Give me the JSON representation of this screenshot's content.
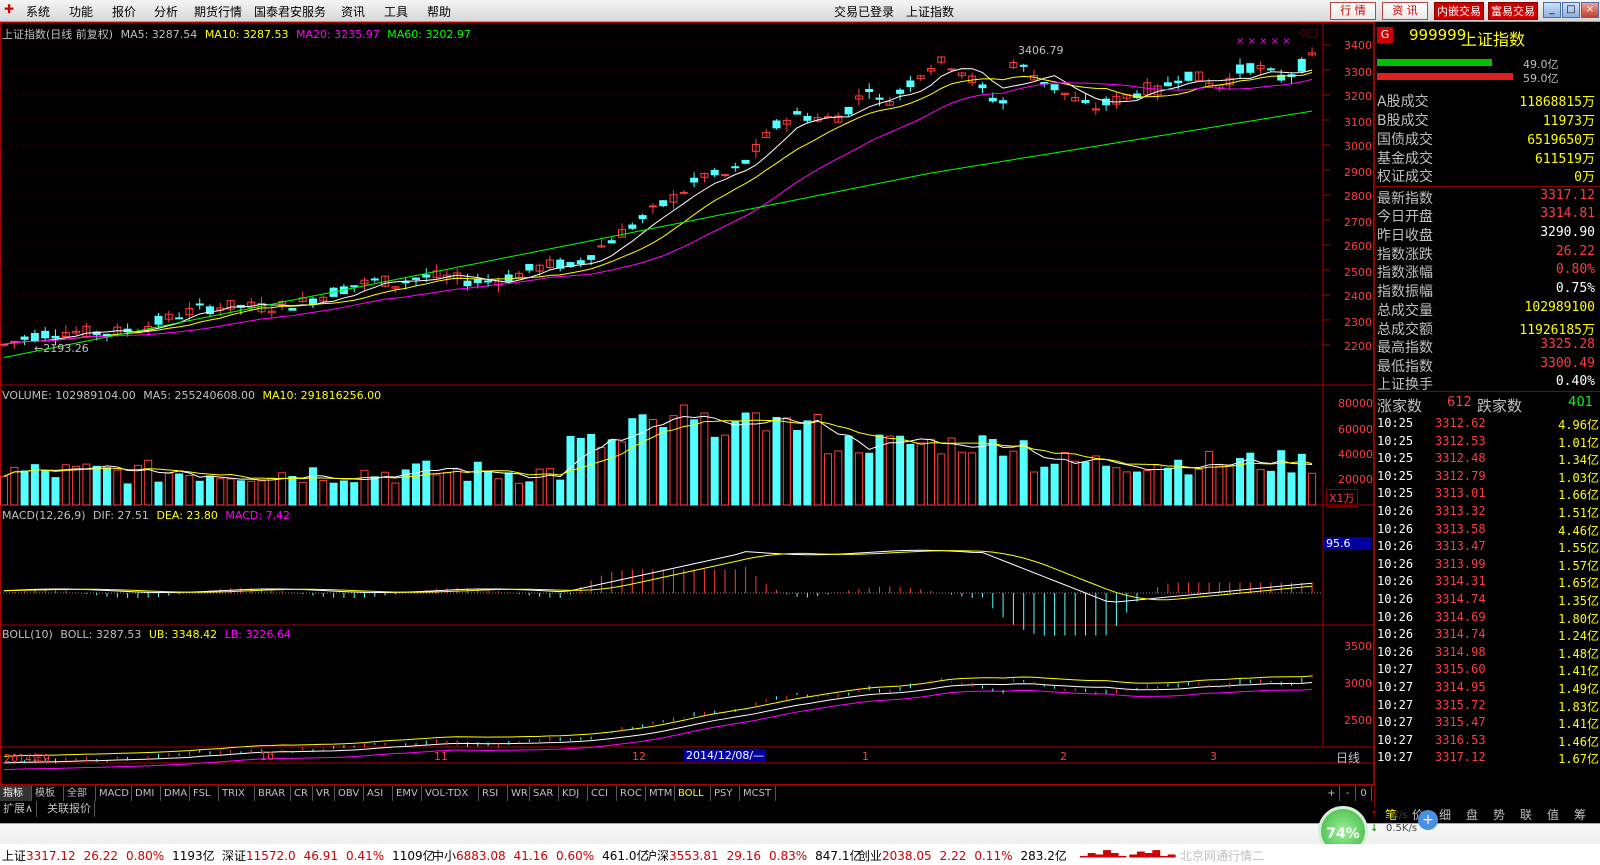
{
  "menu": {
    "items": [
      "系统",
      "功能",
      "报价",
      "分析",
      "期货行情",
      "国泰君安服务",
      "资讯",
      "工具",
      "帮助"
    ],
    "status_text": "交易已登录",
    "index_name": "上证指数",
    "buttons": [
      "行 情",
      "资 讯"
    ],
    "red_buttons": [
      "内嵌交易",
      "富易交易"
    ]
  },
  "main_panel": {
    "title": "上证指数(日线 前复权)",
    "ma5": "MA5: 3287.54",
    "ma10": "MA10: 3287.53",
    "ma20": "MA20: 3235.97",
    "ma60": "MA60: 3202.97",
    "high_label": "3406.79",
    "low_label": "←2193.26",
    "y_ticks": [
      "3400",
      "3300",
      "3200",
      "3100",
      "3000",
      "2900",
      "2800",
      "2700",
      "2600",
      "2500",
      "2400",
      "2300",
      "2200"
    ]
  },
  "volume_panel": {
    "volume": "VOLUME: 102989104.00",
    "ma5": "MA5: 255240608.00",
    "ma10": "MA10: 291816256.00",
    "y_ticks": [
      "80000",
      "60000",
      "40000",
      "20000"
    ],
    "unit": "X1万"
  },
  "macd_panel": {
    "title": "MACD(12,26,9)",
    "dif": "DIF: 27.51",
    "dea": "DEA: 23.80",
    "macd": "MACD: 7.42",
    "marker": "95.6"
  },
  "boll_panel": {
    "title": "BOLL(10)",
    "boll": "BOLL: 3287.53",
    "ub": "UB: 3348.42",
    "lb": "LB: 3226.64",
    "y_ticks": [
      "3500",
      "3000",
      "2500"
    ]
  },
  "time_axis": {
    "labels": [
      "2014年9",
      "10",
      "11",
      "12",
      "1",
      "2",
      "3"
    ],
    "cursor": "2014/12/08/—",
    "period": "日线"
  },
  "indicator_tabs": [
    "指标",
    "模板",
    "全部",
    "MACD",
    "DMI",
    "DMA",
    "FSL",
    "TRIX",
    "BRAR",
    "CR",
    "VR",
    "OBV",
    "ASI",
    "EMV",
    "VOL-TDX",
    "RSI",
    "WR",
    "SAR",
    "KDJ",
    "CCI",
    "ROC",
    "MTM",
    "BOLL",
    "PSY",
    "MCST"
  ],
  "selected_tab": "BOLL",
  "bottom_tabs": [
    "扩展∧",
    "关联报价"
  ],
  "zoom_buttons": [
    "+",
    "-",
    "0"
  ],
  "right_panel": {
    "code": "999999",
    "name": "上证指数",
    "icon_letter": "G",
    "bar_top": "49.0亿",
    "bar_bottom": "59.0亿",
    "stats": [
      {
        "k": "A股成交",
        "v": "11868815万",
        "c": "#ffff00"
      },
      {
        "k": "B股成交",
        "v": "11973万",
        "c": "#ffff00"
      },
      {
        "k": "国债成交",
        "v": "6519650万",
        "c": "#ffff00"
      },
      {
        "k": "基金成交",
        "v": "611519万",
        "c": "#ffff00"
      },
      {
        "k": "权证成交",
        "v": "0万",
        "c": "#ffff00"
      },
      {
        "k": "最新指数",
        "v": "3317.12",
        "c": "#ff3c3c"
      },
      {
        "k": "今日开盘",
        "v": "3314.81",
        "c": "#ff3c3c"
      },
      {
        "k": "昨日收盘",
        "v": "3290.90",
        "c": "#ffffff"
      },
      {
        "k": "指数涨跌",
        "v": "26.22",
        "c": "#ff3c3c"
      },
      {
        "k": "指数涨幅",
        "v": "0.80%",
        "c": "#ff3c3c"
      },
      {
        "k": "指数振幅",
        "v": "0.75%",
        "c": "#ffffff"
      },
      {
        "k": "总成交量",
        "v": "102989100",
        "c": "#ffff00"
      },
      {
        "k": "总成交额",
        "v": "11926185万",
        "c": "#ffff00"
      },
      {
        "k": "最高指数",
        "v": "3325.28",
        "c": "#ff3c3c"
      },
      {
        "k": "最低指数",
        "v": "3300.49",
        "c": "#ff3c3c"
      },
      {
        "k": "上证换手",
        "v": "0.40%",
        "c": "#ffffff"
      }
    ],
    "rise_label": "涨家数",
    "rise_count": "612",
    "fall_label": "跌家数",
    "fall_count": "401",
    "ticks": [
      [
        "10:25",
        "3312.62",
        "4.96亿"
      ],
      [
        "10:25",
        "3312.53",
        "1.01亿"
      ],
      [
        "10:25",
        "3312.48",
        "1.34亿"
      ],
      [
        "10:25",
        "3312.79",
        "1.03亿"
      ],
      [
        "10:25",
        "3313.01",
        "1.66亿"
      ],
      [
        "10:26",
        "3313.32",
        "1.51亿"
      ],
      [
        "10:26",
        "3313.58",
        "4.46亿"
      ],
      [
        "10:26",
        "3313.47",
        "1.55亿"
      ],
      [
        "10:26",
        "3313.99",
        "1.57亿"
      ],
      [
        "10:26",
        "3314.31",
        "1.65亿"
      ],
      [
        "10:26",
        "3314.74",
        "1.35亿"
      ],
      [
        "10:26",
        "3314.69",
        "1.80亿"
      ],
      [
        "10:26",
        "3314.74",
        "1.24亿"
      ],
      [
        "10:26",
        "3314.98",
        "1.48亿"
      ],
      [
        "10:27",
        "3315.60",
        "1.41亿"
      ],
      [
        "10:27",
        "3314.95",
        "1.49亿"
      ],
      [
        "10:27",
        "3315.72",
        "1.83亿"
      ],
      [
        "10:27",
        "3315.47",
        "1.41亿"
      ],
      [
        "10:27",
        "3316.53",
        "1.46亿"
      ],
      [
        "10:27",
        "3317.12",
        "1.67亿"
      ]
    ],
    "tabs": [
      "笔",
      "价",
      "细",
      "盘",
      "势",
      "联",
      "值",
      "筹"
    ]
  },
  "net": {
    "percent": "74%",
    "up": "1K/s",
    "down": "0.5K/s"
  },
  "ticker": [
    {
      "name": "上证",
      "val": "3317.12",
      "chg": "26.22",
      "pct": "0.80%",
      "amt": "1193亿"
    },
    {
      "name": "深证",
      "val": "11572.0",
      "chg": "46.91",
      "pct": "0.41%",
      "amt": "1109亿"
    },
    {
      "name": "中小",
      "val": "6883.08",
      "chg": "41.16",
      "pct": "0.60%",
      "amt": "461.0亿"
    },
    {
      "name": "沪深",
      "val": "3553.81",
      "chg": "29.16",
      "pct": "0.83%",
      "amt": "847.1亿"
    },
    {
      "name": "创业",
      "val": "2038.05",
      "chg": "2.22",
      "pct": "0.11%",
      "amt": "283.2亿"
    }
  ],
  "ticker_right": "北京网通行情二",
  "colors": {
    "up": "#ff3c3c",
    "down": "#54ffff",
    "ma5": "#ffffff",
    "ma10": "#ffff00",
    "ma20": "#ff00ff",
    "ma60": "#00ff00"
  }
}
